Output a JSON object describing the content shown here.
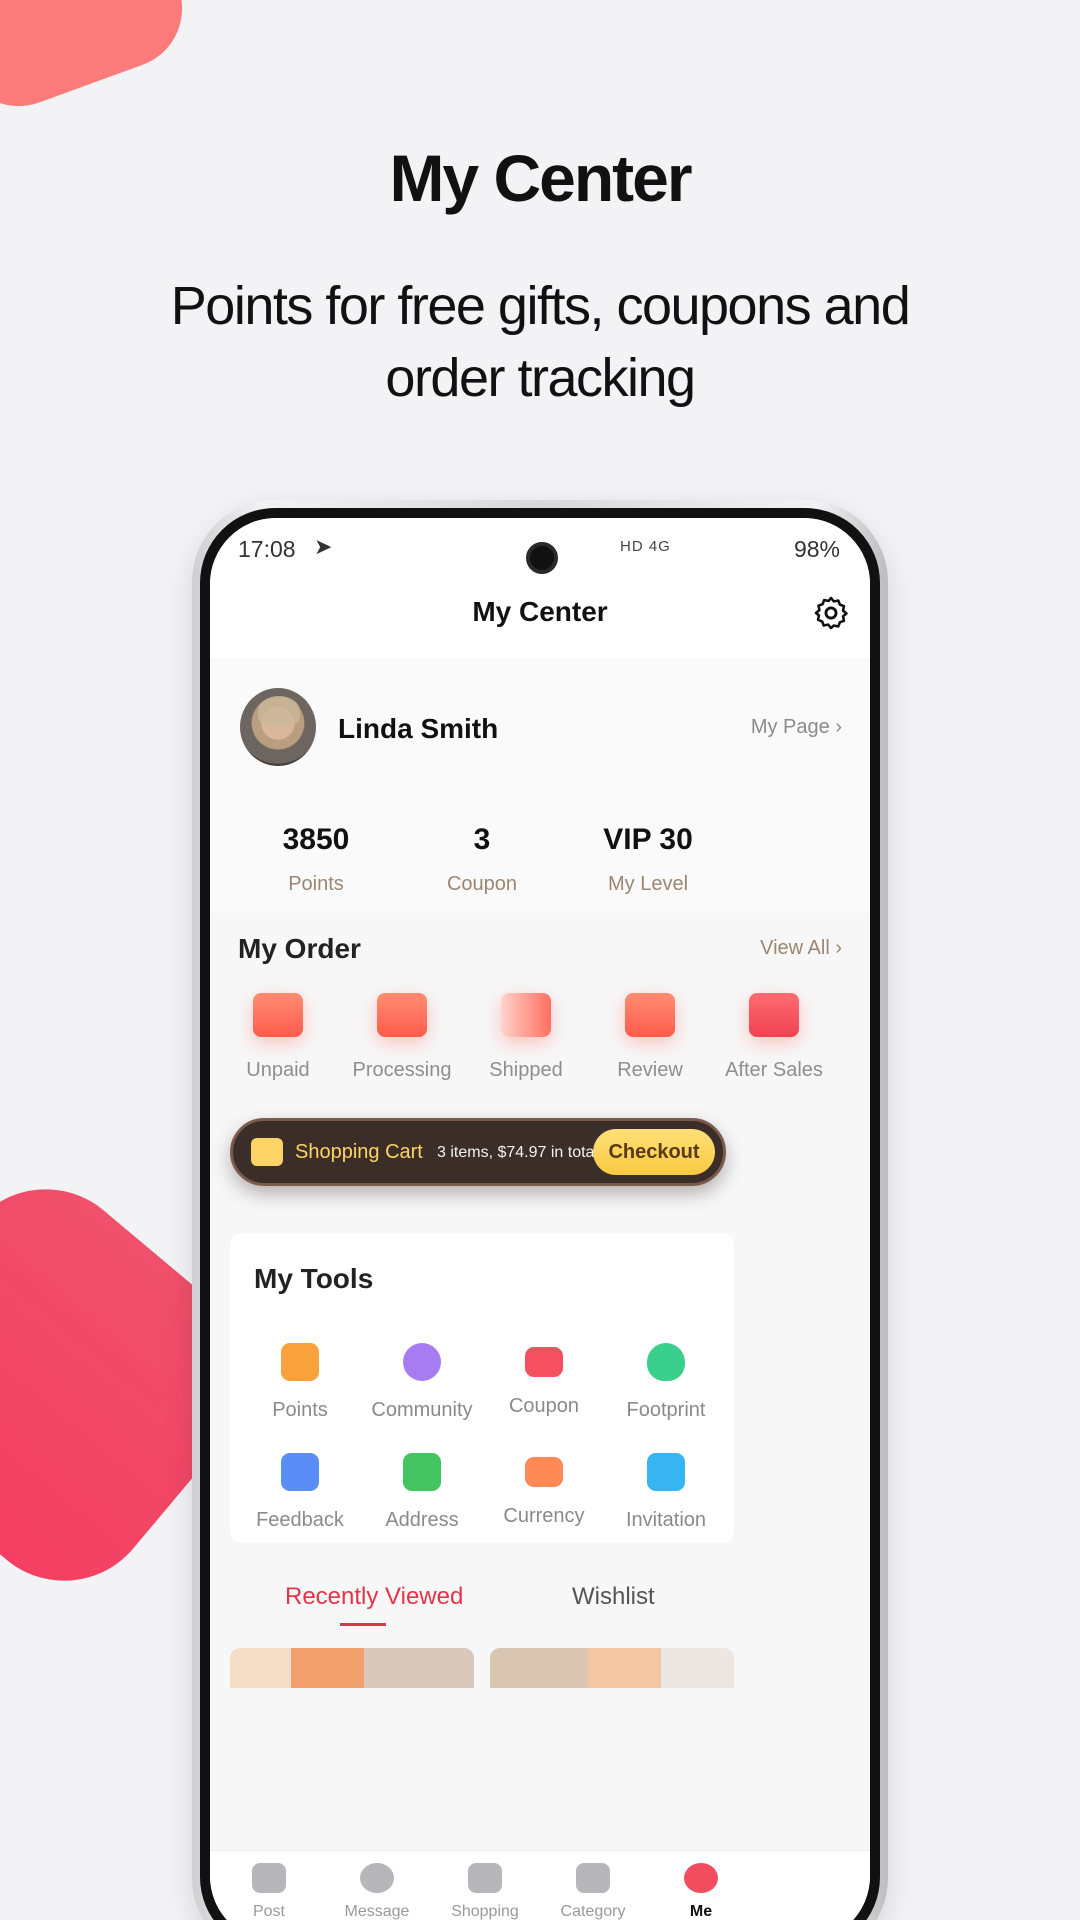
{
  "hero": {
    "title": "My Center",
    "subtitle": "Points for free gifts, coupons and order tracking"
  },
  "status_bar": {
    "time": "17:08",
    "network_icons": "HD 4G",
    "battery": "98%"
  },
  "header": {
    "title": "My Center",
    "settings_icon": "gear-icon"
  },
  "profile": {
    "name": "Linda Smith",
    "my_page": "My Page",
    "stats": [
      {
        "value": "3850",
        "label": "Points"
      },
      {
        "value": "3",
        "label": "Coupon"
      },
      {
        "value": "VIP 30",
        "label": "My Level"
      }
    ]
  },
  "orders": {
    "title": "My Order",
    "view_all": "View All",
    "items": [
      {
        "label": "Unpaid",
        "icon": "wallet-icon"
      },
      {
        "label": "Processing",
        "icon": "box-icon"
      },
      {
        "label": "Shipped",
        "icon": "truck-icon"
      },
      {
        "label": "Review",
        "icon": "chat-icon"
      },
      {
        "label": "After Sales",
        "icon": "return-icon"
      }
    ]
  },
  "cart": {
    "label": "Shopping Cart",
    "detail": "3 items, $74.97 in total",
    "checkout": "Checkout"
  },
  "tools": {
    "title": "My Tools",
    "items": [
      {
        "label": "Points",
        "icon": "bag-icon",
        "color": "#f9a23b"
      },
      {
        "label": "Community",
        "icon": "people-icon",
        "color": "#a77cf0"
      },
      {
        "label": "Coupon",
        "icon": "ticket-icon",
        "color": "#f4505f"
      },
      {
        "label": "Footprint",
        "icon": "paw-icon",
        "color": "#3bcf8d"
      },
      {
        "label": "Feedback",
        "icon": "message-icon",
        "color": "#5b8df6"
      },
      {
        "label": "Address",
        "icon": "calendar-check-icon",
        "color": "#44c461"
      },
      {
        "label": "Currency",
        "icon": "card-icon",
        "color": "#ff8a56"
      },
      {
        "label": "Invitation",
        "icon": "gift-icon",
        "color": "#36b5f0"
      }
    ]
  },
  "tabs": {
    "recently_viewed": "Recently Viewed",
    "wishlist": "Wishlist"
  },
  "bottom_nav": [
    {
      "label": "Post",
      "icon": "diamond-icon"
    },
    {
      "label": "Message",
      "icon": "message-bubble-icon"
    },
    {
      "label": "Shopping",
      "icon": "home-icon"
    },
    {
      "label": "Category",
      "icon": "tag-icon"
    },
    {
      "label": "Me",
      "icon": "smile-icon"
    }
  ]
}
